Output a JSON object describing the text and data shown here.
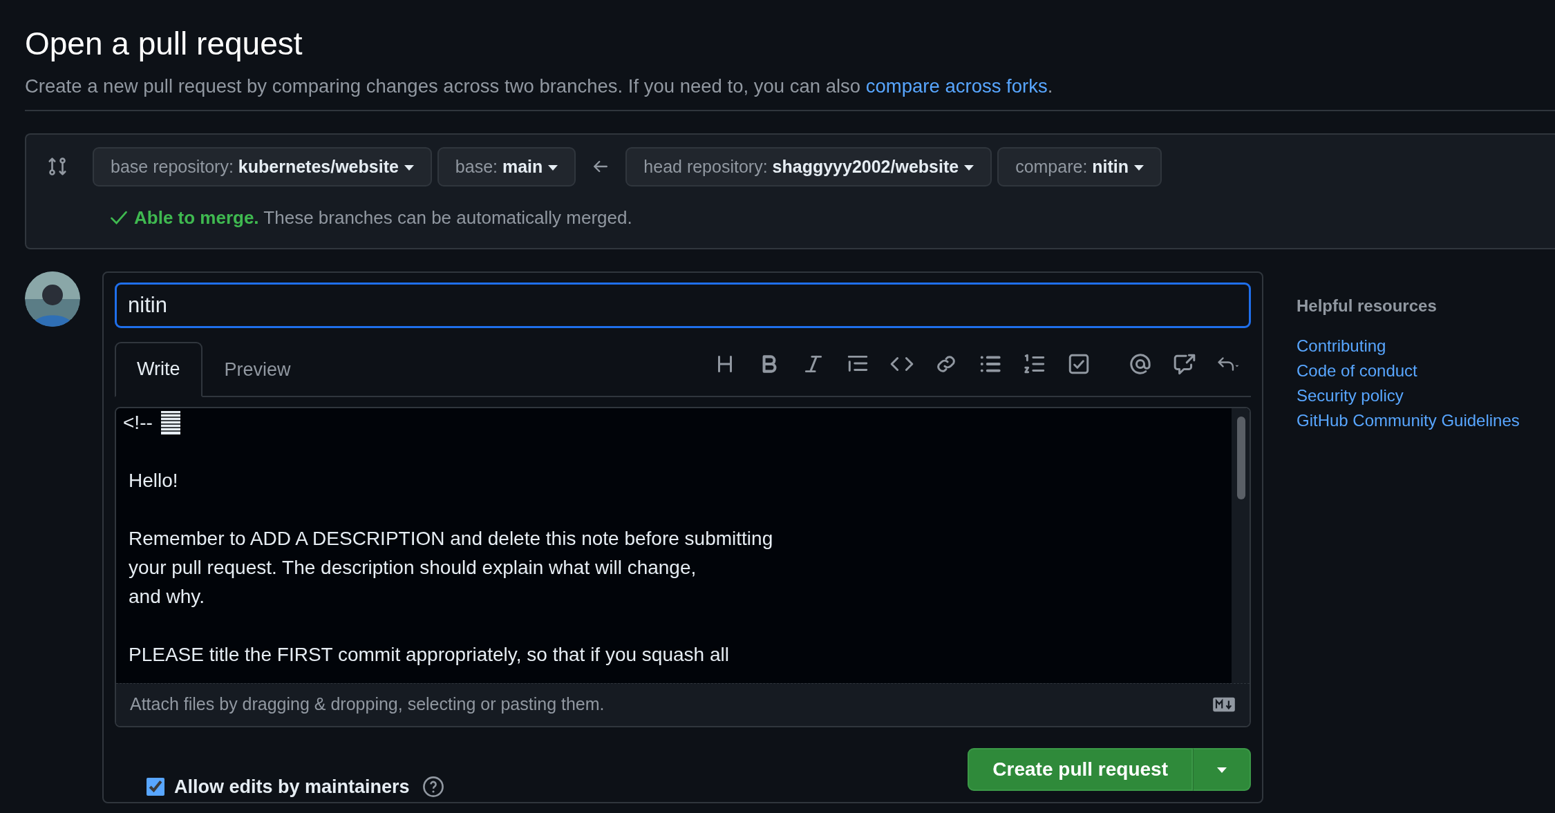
{
  "page": {
    "title": "Open a pull request",
    "subtitle": "Create a new pull request by comparing changes across two branches. If you need to, you can also",
    "subtitle_link": "compare across forks",
    "subtitle_end": "."
  },
  "branches": [
    {
      "label": "base repository:",
      "value": "kubernetes/website"
    },
    {
      "label": "base:",
      "value": "main"
    },
    {
      "label": "head repository:",
      "value": "shaggyyy2002/website"
    },
    {
      "label": "compare:",
      "value": "nitin"
    }
  ],
  "merge_status": {
    "kind": "ok",
    "status": "Able to merge.",
    "message": "These branches can be automatically merged."
  },
  "form": {
    "title_value": "nitin",
    "tabs": [
      {
        "label": "Write",
        "selected": true
      },
      {
        "label": "Preview",
        "selected": false
      }
    ],
    "body_paragraphs": [
      [
        "<!--"
      ],
      [
        "Hello!"
      ],
      [
        "Remember to ADD A DESCRIPTION and delete this note before submitting",
        "your pull request. The description should explain what will change,",
        "and why."
      ],
      [
        "PLEASE title the FIRST commit appropriately, so that if you squash all"
      ]
    ],
    "attach_hint": "Attach files by dragging & dropping, selecting or pasting them.",
    "allow_edits": {
      "label": "Allow edits by maintainers",
      "checked": true
    },
    "submit": "Create pull request"
  },
  "sidebar": {
    "heading": "Helpful resources",
    "links": [
      "Contributing",
      "Code of conduct",
      "Security policy",
      "GitHub Community Guidelines"
    ]
  }
}
